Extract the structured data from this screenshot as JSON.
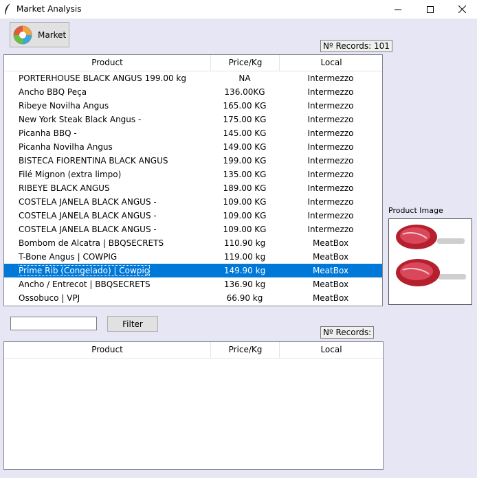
{
  "window": {
    "title": "Market Analysis"
  },
  "toolbar": {
    "market_label": "Market"
  },
  "records_top": {
    "label": "Nº Records: 101"
  },
  "records_bottom": {
    "label": "Nº Records:"
  },
  "columns": {
    "product": "Product",
    "price": "Price/Kg",
    "local": "Local"
  },
  "rows": [
    {
      "product": "PORTERHOUSE  BLACK ANGUS  199.00 kg",
      "price": "NA",
      "local": "Intermezzo"
    },
    {
      "product": "Ancho BBQ Peça",
      "price": "136.00KG",
      "local": "Intermezzo"
    },
    {
      "product": "Ribeye Novilha Angus",
      "price": "165.00 KG",
      "local": "Intermezzo"
    },
    {
      "product": "New York Steak  Black Angus -",
      "price": "175.00 KG",
      "local": "Intermezzo"
    },
    {
      "product": "Picanha BBQ -",
      "price": "145.00 KG",
      "local": "Intermezzo"
    },
    {
      "product": "Picanha Novilha Angus",
      "price": "149.00 KG",
      "local": "Intermezzo"
    },
    {
      "product": "BISTECA FIORENTINA BLACK ANGUS",
      "price": "199.00 KG",
      "local": "Intermezzo"
    },
    {
      "product": "Filé Mignon (extra limpo)",
      "price": "135.00 KG",
      "local": "Intermezzo"
    },
    {
      "product": "RIBEYE BLACK ANGUS",
      "price": "189.00 KG",
      "local": "Intermezzo"
    },
    {
      "product": "COSTELA JANELA BLACK ANGUS -",
      "price": "109.00 KG",
      "local": "Intermezzo"
    },
    {
      "product": "COSTELA JANELA BLACK ANGUS -",
      "price": "109.00 KG",
      "local": "Intermezzo"
    },
    {
      "product": "COSTELA JANELA BLACK ANGUS -",
      "price": "109.00 KG",
      "local": "Intermezzo"
    },
    {
      "product": "Bombom de Alcatra | BBQSECRETS",
      "price": "110.90 kg",
      "local": "MeatBox"
    },
    {
      "product": "T-Bone Angus | COWPIG",
      "price": "119.00 kg",
      "local": "MeatBox"
    },
    {
      "product": "Prime Rib (Congelado) | Cowpig",
      "price": "149.90 kg",
      "local": "MeatBox",
      "selected": true
    },
    {
      "product": "Ancho / Entrecot | BBQSECRETS",
      "price": "136.90 kg",
      "local": "MeatBox"
    },
    {
      "product": "Ossobuco | VPJ",
      "price": "66.90 kg",
      "local": "MeatBox"
    }
  ],
  "image_panel": {
    "label": "Product Image",
    "icon": "meat-image"
  },
  "filter": {
    "value": "",
    "button_label": "Filter"
  },
  "colors": {
    "selection": "#0078d7",
    "background": "#e6e6f5"
  }
}
